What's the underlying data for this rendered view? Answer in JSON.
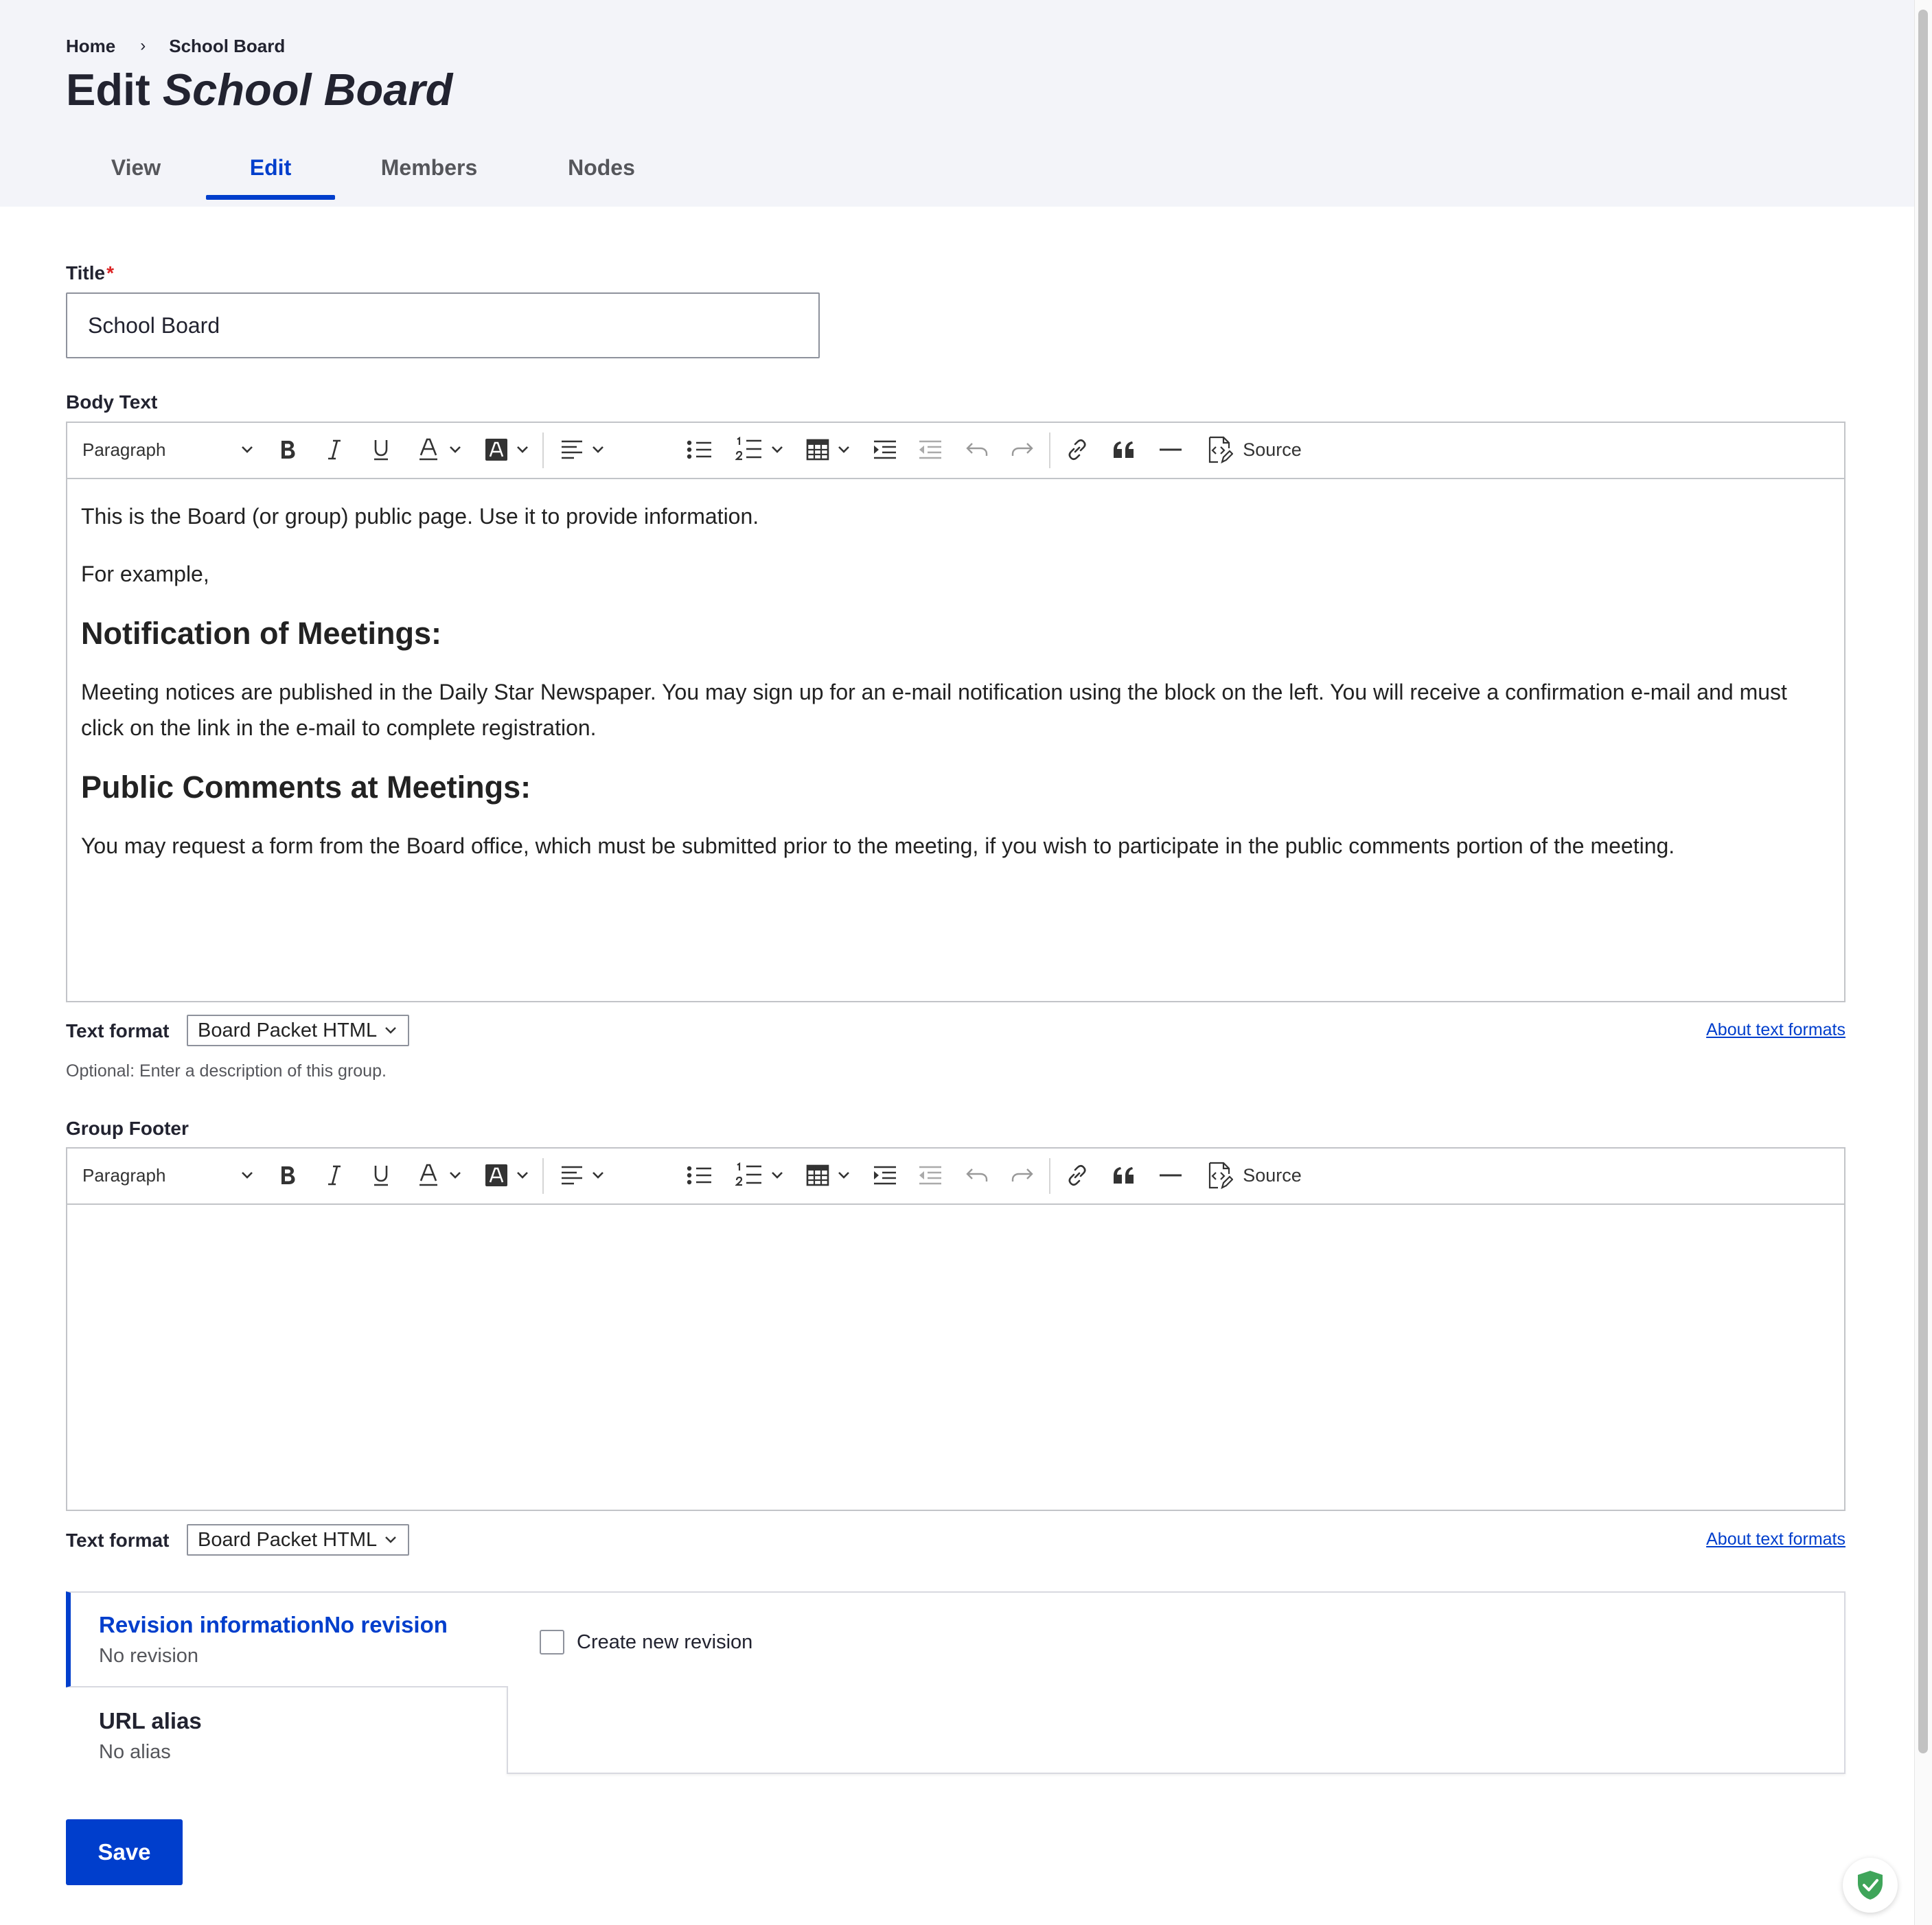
{
  "breadcrumb": {
    "home": "Home",
    "separator": "›",
    "current": "School Board"
  },
  "page_title": {
    "prefix": "Edit",
    "emphasis": "School Board"
  },
  "tabs": [
    {
      "label": "View",
      "active": false
    },
    {
      "label": "Edit",
      "active": true
    },
    {
      "label": "Members",
      "active": false
    },
    {
      "label": "Nodes",
      "active": false
    }
  ],
  "form": {
    "title_label": "Title",
    "required_mark": "*",
    "title_value": "School Board",
    "body_label": "Body Text",
    "footer_label": "Group Footer",
    "toolbar": {
      "paragraph_style": "Paragraph",
      "source_label": "Source",
      "icons": [
        "bold-icon",
        "italic-icon",
        "underline-icon",
        "font-color-icon",
        "font-background-color-icon",
        "alignment-icon",
        "bulleted-list-icon",
        "numbered-list-icon",
        "table-icon",
        "indent-icon",
        "outdent-icon",
        "undo-icon",
        "redo-icon",
        "link-icon",
        "blockquote-icon",
        "horizontal-line-icon",
        "source-icon"
      ]
    },
    "body_content": {
      "p1": "This is the Board (or group) public page.  Use it to provide information.",
      "p2": "For example,",
      "h1": "Notification of Meetings:",
      "p3": "Meeting notices are published in the Daily Star Newspaper.  You may sign up for an e-mail notification using the block on the left.  You will receive a confirmation e-mail and must click on the link in the e-mail to complete registration.",
      "h2": "Public Comments at Meetings:",
      "p4": "You may request a form from the Board office, which must be submitted prior to the meeting, if you wish to participate in the public comments portion of the meeting."
    },
    "text_format_label": "Text format",
    "text_format_value": "Board Packet HTML",
    "about_text_formats": "About text formats",
    "body_help": "Optional: Enter a description of this group."
  },
  "vertical_tabs": {
    "revision": {
      "title": "Revision informationNo revision",
      "summary": "No revision"
    },
    "url_alias": {
      "title": "URL alias",
      "summary": "No alias"
    },
    "checkbox_label": "Create new revision",
    "checkbox_checked": false
  },
  "save_label": "Save",
  "colors": {
    "accent": "#003ecc",
    "required": "#dc2323",
    "header_bg": "#f3f4f9",
    "text": "#222330"
  }
}
